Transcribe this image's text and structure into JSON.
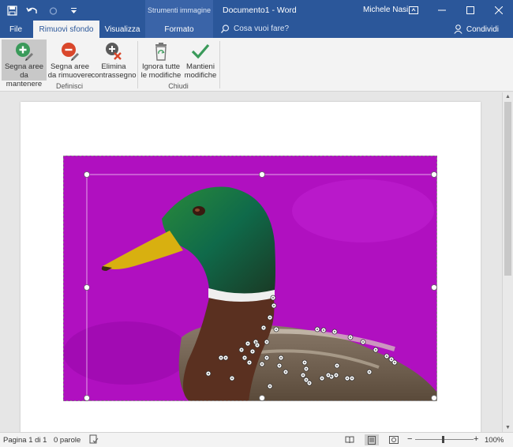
{
  "titlebar": {
    "tools_tab": "Strumenti immagine",
    "doc_title": "Documento1  -  Word",
    "user": "Michele Nasi",
    "restore_label": "▣"
  },
  "tabs": [
    {
      "label": "File"
    },
    {
      "label": "Rimuovi sfondo"
    },
    {
      "label": "Visualizza"
    },
    {
      "label": "Formato"
    }
  ],
  "tellme": {
    "label": "Cosa vuoi fare?"
  },
  "share": {
    "label": "Condividi"
  },
  "ribbon": {
    "buttons": [
      {
        "line1": "Segna aree",
        "line2": "da mantenere",
        "icon": "plus-pencil-icon"
      },
      {
        "line1": "Segna aree",
        "line2": "da rimuovere",
        "icon": "minus-pencil-icon"
      },
      {
        "line1": "Elimina",
        "line2": "contrassegno",
        "icon": "delete-mark-icon"
      },
      {
        "line1": "Ignora tutte",
        "line2": "le modifiche",
        "icon": "recycle-bin-icon"
      },
      {
        "line1": "Mantieni",
        "line2": "modifiche",
        "icon": "checkmark-icon"
      }
    ],
    "groups": [
      {
        "label": "Definisci"
      },
      {
        "label": "Chiudi"
      }
    ]
  },
  "statusbar": {
    "page": "Pagina 1 di 1",
    "words": "0 parole",
    "zoom": "100%",
    "zoom_minus": "−",
    "zoom_plus": "+"
  },
  "colors": {
    "brand": "#2b579a",
    "remove_area": "#b010c0",
    "keep_green": "#3a9a5a",
    "remove_red": "#d9472b"
  }
}
